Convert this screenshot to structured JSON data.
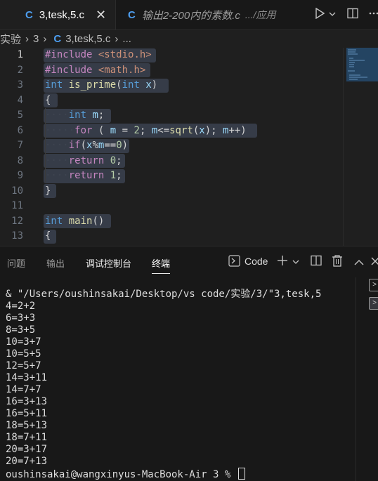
{
  "tabs": [
    {
      "icon": "C",
      "label": "3,tesk,5.c",
      "close": "✕"
    },
    {
      "icon": "C",
      "label": "输出2-200内的素数.c",
      "path": ".../应用"
    }
  ],
  "breadcrumb": [
    "实验",
    "3",
    "3,tesk,5.c",
    "..."
  ],
  "editor": {
    "line_numbers": [
      "1",
      "2",
      "3",
      "4",
      "5",
      "6",
      "7",
      "8",
      "9",
      "10",
      "11",
      "12",
      "13"
    ],
    "current_line": "1"
  },
  "panel": {
    "tabs": [
      "问题",
      "输出",
      "调试控制台",
      "终端"
    ],
    "active_tab": "终端",
    "terminal_name": "Code"
  },
  "terminal": {
    "command": "& \"/Users/oushinsakai/Desktop/vs code/实验/3/\"3,tesk,5",
    "output": [
      "4=2+2",
      "6=3+3",
      "8=3+5",
      "10=3+7",
      "10=5+5",
      "12=5+7",
      "14=3+11",
      "14=7+7",
      "16=3+13",
      "16=5+11",
      "18=5+13",
      "18=7+11",
      "20=3+17",
      "20=7+13"
    ],
    "prompt": "oushinsakai@wangxinyus-MacBook-Air 3 % "
  }
}
